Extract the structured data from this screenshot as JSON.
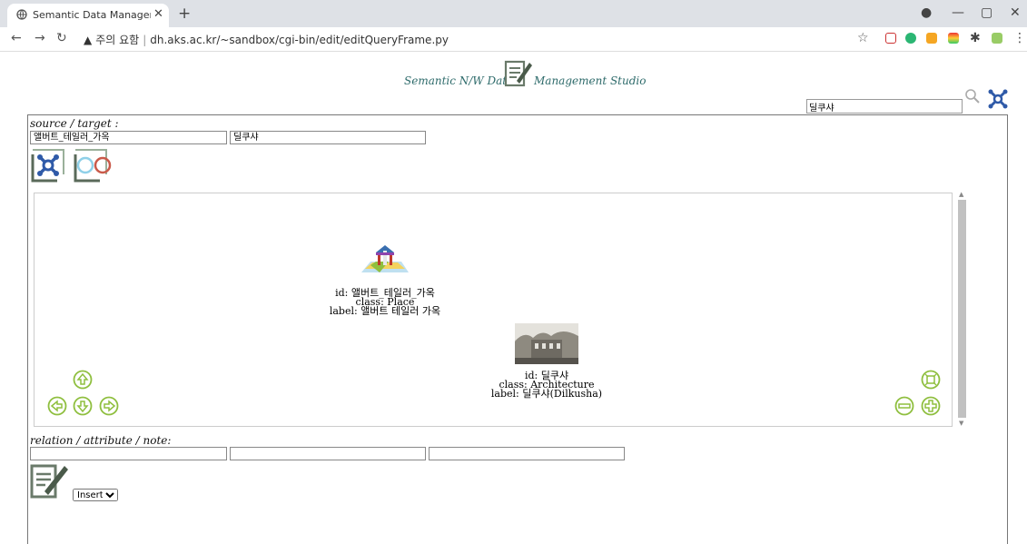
{
  "browser": {
    "tab_title": "Semantic Data Management St",
    "url_warning": "주의 요함",
    "url": "dh.aks.ac.kr/~sandbox/cgi-bin/edit/editQueryFrame.py"
  },
  "header": {
    "title_left": "Semantic N/W Data",
    "title_right": "Management Studio",
    "search_value": "딜쿠샤"
  },
  "source_target": {
    "label": "source / target :",
    "source_value": "앨버트_테일러_가옥",
    "target_value": "딜쿠샤"
  },
  "nodes": [
    {
      "id_line": "id: 앨버트_테일러_가옥",
      "class_line": "class: Place",
      "label_line": "label: 앨버트 테일러 가옥"
    },
    {
      "id_line": "id: 딜쿠샤",
      "class_line": "class: Architecture",
      "label_line": "label: 딜쿠샤(Dilkusha)"
    }
  ],
  "relation": {
    "label": "relation / attribute / note:",
    "relation_value": "",
    "attribute_value": "",
    "note_value": ""
  },
  "action_select": {
    "selected": "Insert"
  },
  "colors": {
    "accent_green": "#8fbf3f",
    "title_teal": "#2e6b6b",
    "network_blue": "#2f5aa8"
  }
}
